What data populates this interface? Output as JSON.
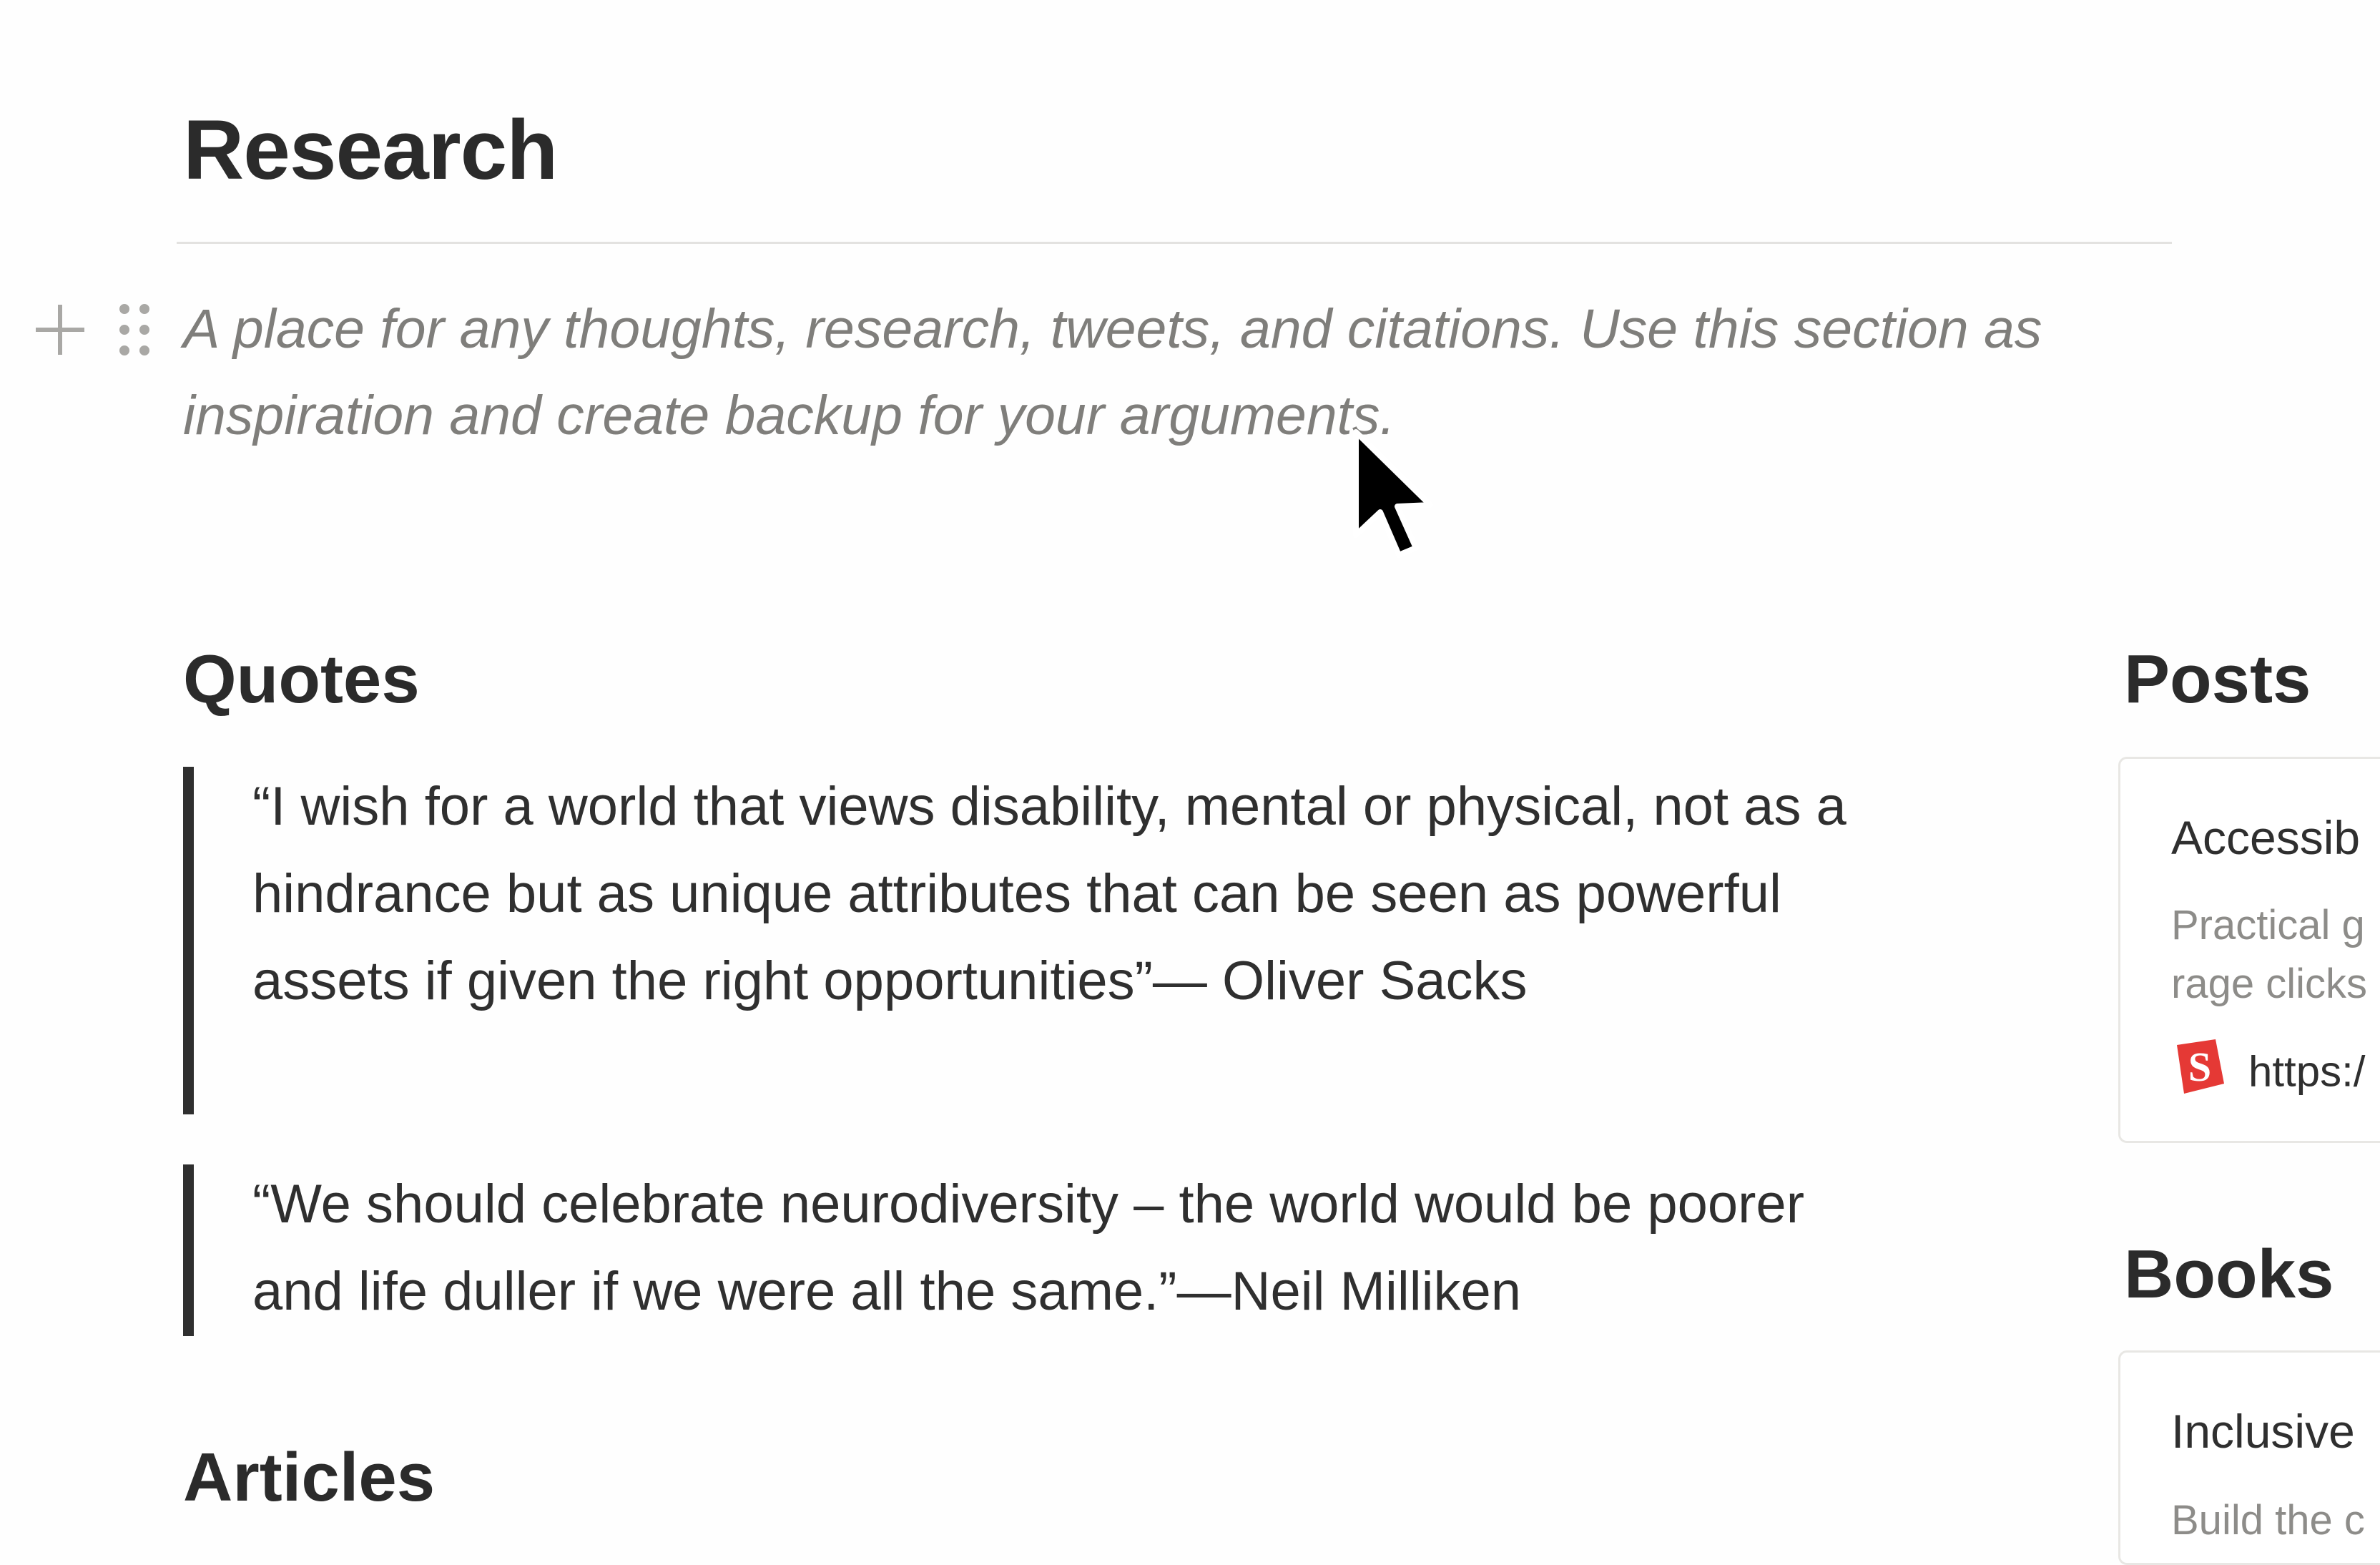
{
  "page": {
    "title": "Research",
    "callout": "A place for any thoughts, research, tweets, and citations. Use this section as inspiration and create backup for your arguments."
  },
  "sections": {
    "quotes_heading": "Quotes",
    "articles_heading": "Articles",
    "posts_heading": "Posts",
    "books_heading": "Books"
  },
  "quotes": [
    {
      "text": "“I wish for a world that views disability, mental or physical, not as a hindrance but as unique attributes that can be seen as powerful assets if given the right opportunities”— Oliver Sacks"
    },
    {
      "text": "“We should celebrate neurodiversity – the world would be poorer and life duller if we were all the same.”—Neil Milliken"
    }
  ],
  "posts_card": {
    "title": "Accessib",
    "desc_line1": "Practical g",
    "desc_line2": "rage clicks",
    "link": "https:/",
    "icon": "smashing-magazine-icon"
  },
  "books_card": {
    "title": "Inclusive",
    "desc_line1": "Build the c"
  },
  "colors": {
    "text": "#2f2f2f",
    "muted": "#7f7e7b",
    "quote_bar": "#2f2f2f",
    "brand_red": "#e53935"
  }
}
